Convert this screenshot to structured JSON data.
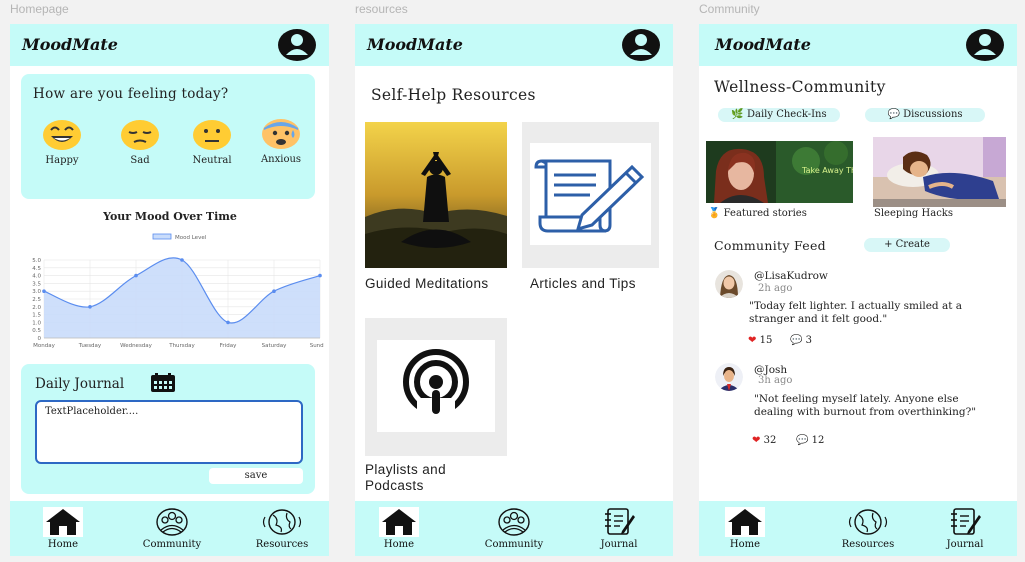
{
  "frames": {
    "homepage": "Homepage",
    "resources": "resources",
    "community": "Community"
  },
  "app": {
    "logo": "MoodMate",
    "avatar_icon": "user-avatar-icon",
    "header_color": "#c5fbf8"
  },
  "homepage": {
    "question": "How are you feeling today?",
    "moods": [
      {
        "label": "Happy",
        "icon": "happy-face-icon"
      },
      {
        "label": "Sad",
        "icon": "sad-face-icon"
      },
      {
        "label": "Neutral",
        "icon": "neutral-face-icon"
      },
      {
        "label": "Anxious",
        "icon": "anxious-face-icon"
      }
    ],
    "journal_title": "Daily Journal",
    "journal_placeholder": "TextPlaceholder....",
    "save_label": "save",
    "nav": [
      {
        "label": "Home",
        "icon": "home-icon"
      },
      {
        "label": "Community",
        "icon": "community-icon"
      },
      {
        "label": "Resources",
        "icon": "globe-icon"
      }
    ]
  },
  "chart_data": {
    "type": "line",
    "title": "Your Mood Over Time",
    "legend": "Mood Level",
    "legend_position": "top",
    "categories": [
      "Monday",
      "Tuesday",
      "Wednesday",
      "Thursday",
      "Friday",
      "Saturday",
      "Sunday"
    ],
    "series": [
      {
        "name": "Mood Level",
        "values": [
          3,
          2,
          4,
          5,
          1,
          3,
          4
        ]
      }
    ],
    "y_ticks": [
      "0",
      "0.5",
      "1.0",
      "1.5",
      "2.0",
      "2.5",
      "3.0",
      "3.5",
      "4.0",
      "4.5",
      "5.0"
    ],
    "ylim": [
      0,
      5
    ],
    "grid": true,
    "line_color": "#5b8def",
    "fill_color": "#c9dcfb"
  },
  "resources": {
    "title": "Self-Help Resources",
    "items": [
      {
        "label": "Guided Meditations",
        "icon": "meditation-image"
      },
      {
        "label": "Articles and Tips",
        "icon": "document-pen-icon"
      },
      {
        "label": "Playlists and Podcasts",
        "icon": "podcast-icon"
      }
    ],
    "nav": [
      {
        "label": "Home",
        "icon": "home-icon"
      },
      {
        "label": "Community",
        "icon": "community-icon"
      },
      {
        "label": "Journal",
        "icon": "journal-icon"
      }
    ]
  },
  "community": {
    "title": "Wellness-Community",
    "pills": [
      {
        "label": "🌿 Daily Check-Ins"
      },
      {
        "label": "💬 Discussions"
      }
    ],
    "stories": [
      {
        "label": "🏅 Featured stories",
        "image_text": "Take Away The Shame"
      },
      {
        "label": "Sleeping Hacks"
      }
    ],
    "feed_title": "Community Feed",
    "create_label": "+ Create",
    "posts": [
      {
        "user": "@LisaKudrow",
        "time": "2h ago",
        "text": "\"Today felt lighter. I actually smiled at a stranger and it felt good.\"",
        "likes": "15",
        "comments": "3"
      },
      {
        "user": "@Josh",
        "time": "3h ago",
        "text": "\"Not feeling myself lately. Anyone else dealing with burnout from overthinking?\"",
        "likes": "32",
        "comments": "12"
      }
    ],
    "nav": [
      {
        "label": "Home",
        "icon": "home-icon"
      },
      {
        "label": "Resources",
        "icon": "globe-icon"
      },
      {
        "label": "Journal",
        "icon": "journal-icon"
      }
    ]
  }
}
